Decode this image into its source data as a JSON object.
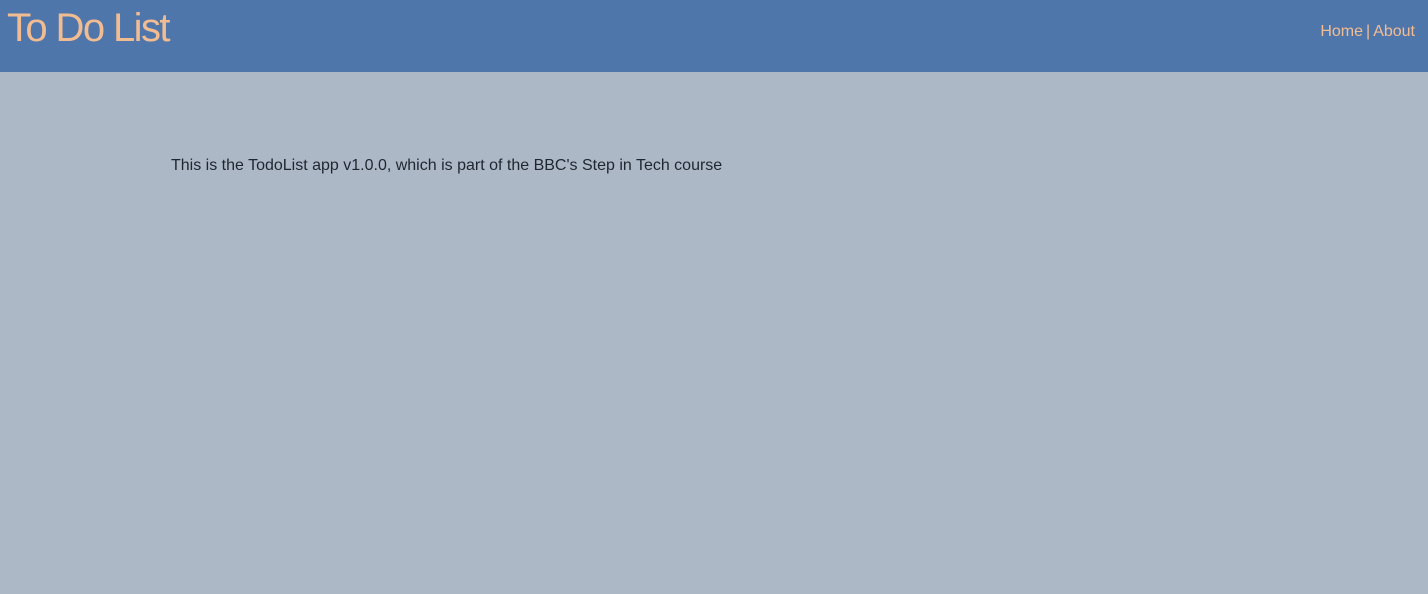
{
  "header": {
    "title": "To Do List",
    "nav": {
      "home_label": "Home",
      "separator": "|",
      "about_label": "About"
    }
  },
  "main": {
    "about_text": "This is the TodoList app v1.0.0, which is part of the BBC's Step in Tech course"
  },
  "colors": {
    "header_background": "#4e76aa",
    "page_background": "#adb8c6",
    "accent_text": "#f2bc93",
    "body_text": "#1f2630"
  }
}
